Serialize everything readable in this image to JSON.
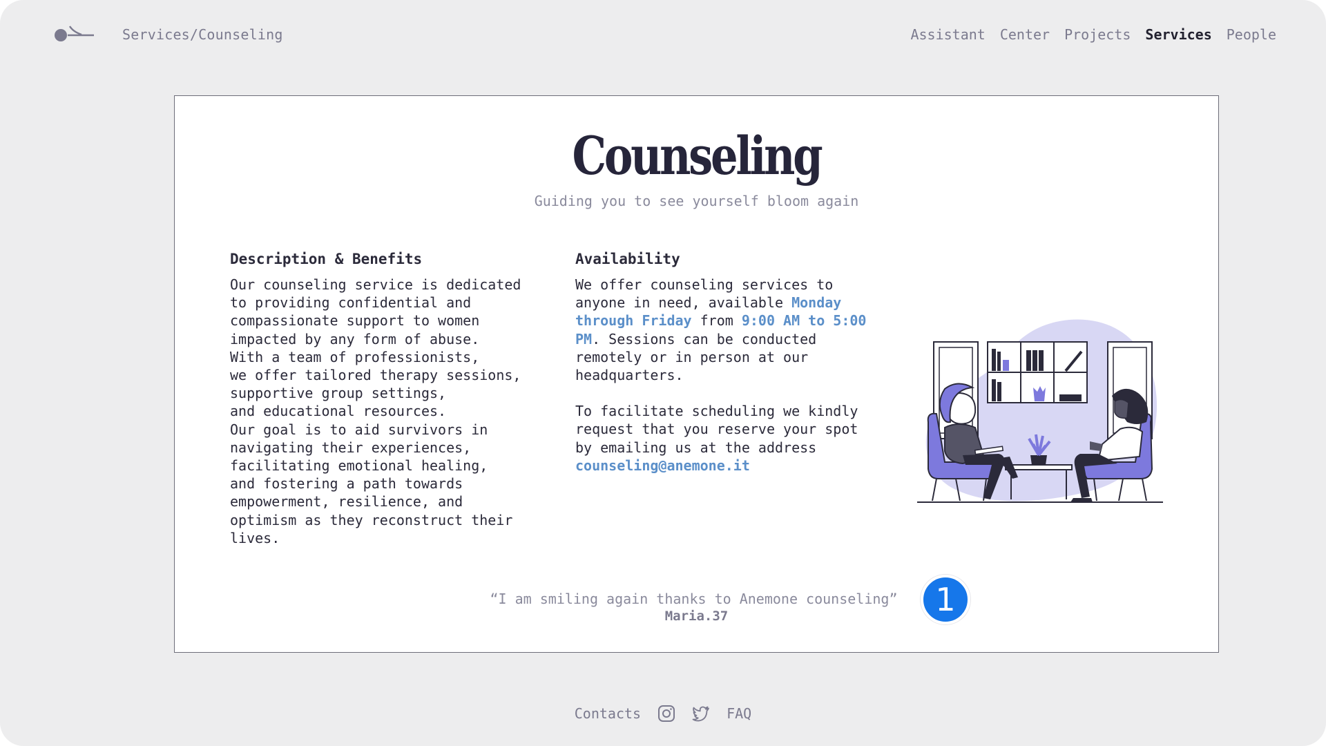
{
  "header": {
    "breadcrumb": "Services/Counseling",
    "nav": [
      {
        "label": "Assistant"
      },
      {
        "label": "Center"
      },
      {
        "label": "Projects"
      },
      {
        "label": "Services",
        "active": true
      },
      {
        "label": "People"
      }
    ]
  },
  "card": {
    "title": "Counseling",
    "subtitle": "Guiding you to see yourself bloom again",
    "description": {
      "heading": "Description & Benefits",
      "body": "Our counseling service is dedicated\nto providing confidential and\ncompassionate support to women\nimpacted by any form of abuse.\nWith a team of professionists,\nwe offer tailored therapy sessions,\nsupportive group settings,\nand educational resources.\nOur goal is to aid survivors in\nnavigating their experiences,\nfacilitating emotional healing,\nand fostering a path towards\nempowerment, resilience, and\noptimism as they reconstruct their\nlives."
    },
    "availability": {
      "heading": "Availability",
      "p1_a": "We offer counseling services to\nanyone in need, available ",
      "p1_days": "Monday\nthrough Friday",
      "p1_b": " from ",
      "p1_hours": "9:00 AM to 5:00\nPM",
      "p1_c": ". Sessions can be conducted\nremotely or in person at our\nheadquarters.",
      "p2": "To facilitate scheduling we kindly\nrequest that you reserve your spot\nby emailing us at the address",
      "email": "counseling@anemone.it"
    },
    "quote": "“I am smiling again thanks to Anemone counseling”",
    "quote_author": "Maria.37"
  },
  "marker": {
    "label": "1"
  },
  "footer": {
    "contacts": "Contacts",
    "instagram_icon": "instagram-icon",
    "twitter_icon": "twitter-icon",
    "faq": "FAQ"
  },
  "colors": {
    "background": "#ededee",
    "text": "#2b2a3a",
    "muted": "#7b7a8e",
    "accent": "#5b8fc9",
    "illustration": "#7d79dd",
    "marker": "#1677ea"
  }
}
